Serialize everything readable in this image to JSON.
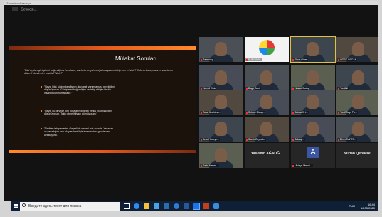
{
  "window": {
    "title": "Zoom Konferansiya"
  },
  "screen_share": {
    "label": "Sehnesi..."
  },
  "slide": {
    "title": "Mülakat Soruları",
    "intro": "\"Dini açıdan görüşlerini beğendiğiniz hocaların, vaizlerin sosyal medya hesaplarını takip eder misiniz? Onların konuşmalarını vaazlarını düzenli olarak izler misiniz? Niçin?\"",
    "bullets": [
      "\"Hayır. Dini, kişinin kendisinin okuyarak yorumlaması gerektiğini düşünüyorum. Görüşlerini beğendiğim ve takip ettiğim bir din insanı bulunmamaktadır.\"",
      "\"Hayır. Bu devirde tüm hocaların dinimizi yanlış yorumladığını düşünüyorum. Takip etme ihtiyacı görmüyorum.\"",
      "\"Nadiren takip ederim. Geçerli bir nedeni yok aslında. Yaşanan ve yaşadığım bazı olaylar beni öyle insanlardan, gruplardan uzaklaştırdı.\""
    ]
  },
  "participants": [
    {
      "name": "Samsung",
      "style": "video"
    },
    {
      "name": "EUROSOC",
      "style": "logo"
    },
    {
      "name": "Elnur Aliyev",
      "style": "video",
      "active": true
    },
    {
      "name": "OZGE OZCAN",
      "style": "video"
    },
    {
      "name": "Hamid Gulu",
      "style": "video"
    },
    {
      "name": "Bagir Sakir",
      "style": "video"
    },
    {
      "name": "Hasan Sadiq",
      "style": "video"
    },
    {
      "name": "Yusifali",
      "style": "video"
    },
    {
      "name": "Tural Ibrahimo...",
      "style": "video"
    },
    {
      "name": "Seidov Elsag...",
      "style": "video"
    },
    {
      "name": "Sahiaaffirt...",
      "style": "video"
    },
    {
      "name": "Yusif Bayr Po...",
      "style": "video"
    },
    {
      "name": "Anar Huseyn...",
      "style": "video"
    },
    {
      "name": "Samir Zeynalov",
      "style": "video"
    },
    {
      "name": "Sabaqi...",
      "style": "video"
    },
    {
      "name": "Elvin CAFER...",
      "style": "video"
    },
    {
      "name": "Farid Hesen...",
      "style": "video"
    },
    {
      "name": "Yasemin AĞAOĞ...",
      "style": "dark"
    },
    {
      "name": "Ulviyye Mehdi...",
      "style": "avatar",
      "letter": "A"
    },
    {
      "name": "Nurlan Qenbere...",
      "style": "dark"
    }
  ],
  "taskbar": {
    "search_placeholder": "Введите здесь текст для поиска",
    "language": "TUR",
    "time": "16:44",
    "date": "16.05.2020"
  }
}
